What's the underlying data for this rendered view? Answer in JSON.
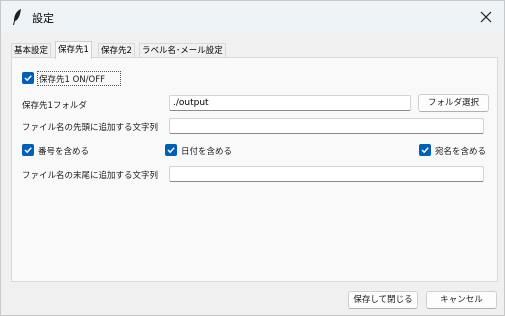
{
  "window": {
    "title": "設定",
    "close_label": "×"
  },
  "tabs": [
    {
      "label": "基本設定"
    },
    {
      "label": "保存先1"
    },
    {
      "label": "保存先2"
    },
    {
      "label": "ラベル名･メール設定"
    }
  ],
  "active_tab": "保存先1",
  "form": {
    "enable_checkbox": {
      "label": "保存先1 ON/OFF",
      "checked": true
    },
    "folder": {
      "label": "保存先1フォルダ",
      "value": "./output",
      "button_label": "フォルダ選択"
    },
    "prefix": {
      "label": "ファイル名の先頭に追加する文字列",
      "value": ""
    },
    "include_number": {
      "label": "番号を含める",
      "checked": true
    },
    "include_date": {
      "label": "日付を含める",
      "checked": true
    },
    "include_recipient": {
      "label": "宛名を含める",
      "checked": true
    },
    "suffix": {
      "label": "ファイル名の末尾に追加する文字列",
      "value": ""
    }
  },
  "footer": {
    "save_close_label": "保存して閉じる",
    "cancel_label": "キャンセル"
  },
  "colors": {
    "accent": "#005fb8",
    "titlebar": "#eef3f8",
    "background": "#f0f0f0"
  }
}
